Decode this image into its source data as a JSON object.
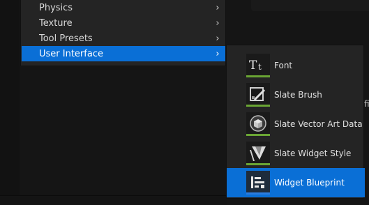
{
  "background": {
    "cutoff_text": "fi"
  },
  "menu": {
    "items": [
      {
        "label": "Physics",
        "chevron": "›"
      },
      {
        "label": "Texture",
        "chevron": "›"
      },
      {
        "label": "Tool Presets",
        "chevron": "›"
      },
      {
        "label": "User Interface",
        "chevron": "›",
        "active": true
      }
    ]
  },
  "submenu": {
    "items": [
      {
        "label": "Font",
        "icon": "font-icon",
        "bar_color": "#6aa534"
      },
      {
        "label": "Slate Brush",
        "icon": "slate-brush-icon",
        "bar_color": "#6aa534"
      },
      {
        "label": "Slate Vector Art Data",
        "icon": "slate-vector-art-icon",
        "bar_color": "#6aa534"
      },
      {
        "label": "Slate Widget Style",
        "icon": "slate-widget-style-icon",
        "bar_color": "#6aa534"
      },
      {
        "label": "Widget Blueprint",
        "icon": "widget-blueprint-icon",
        "bar_color": "#2c7de0",
        "active": true
      }
    ]
  },
  "colors": {
    "accent": "#0a6fd6",
    "menu_bg": "#242424",
    "page_bg": "#151515"
  }
}
